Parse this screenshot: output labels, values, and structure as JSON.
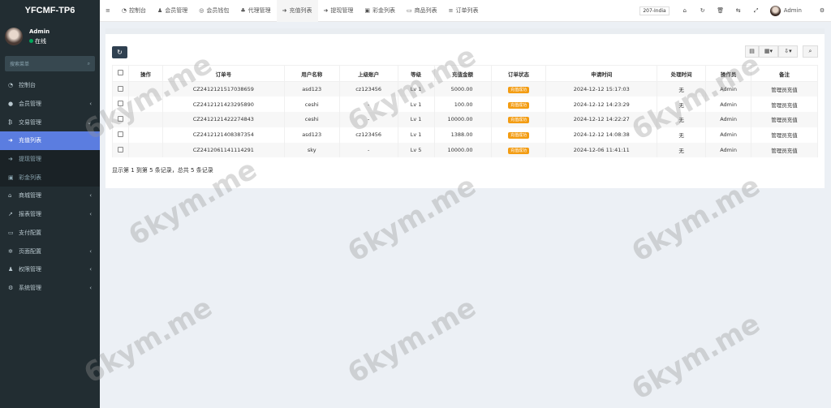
{
  "app_title": "YFCMF-TP6",
  "user": {
    "name": "Admin",
    "status": "在线"
  },
  "search_placeholder": "搜索菜单",
  "sidebar": {
    "items": [
      {
        "label": "控制台",
        "icon": "dashboard-icon",
        "arrow": ""
      },
      {
        "label": "会员管理",
        "icon": "user-circle-icon",
        "arrow": "‹"
      },
      {
        "label": "交易管理",
        "icon": "bitcoin-icon",
        "arrow": "⌄"
      },
      {
        "label": "充值列表",
        "icon": "sign-in-icon",
        "arrow": "",
        "state": "active"
      },
      {
        "label": "提现管理",
        "icon": "sign-out-icon",
        "arrow": "",
        "state": "sub"
      },
      {
        "label": "彩金列表",
        "icon": "gift-icon",
        "arrow": "",
        "state": "sub"
      },
      {
        "label": "商城管理",
        "icon": "home-icon",
        "arrow": "‹"
      },
      {
        "label": "报表管理",
        "icon": "line-chart-icon",
        "arrow": "‹"
      },
      {
        "label": "支付配置",
        "icon": "credit-card-icon",
        "arrow": ""
      },
      {
        "label": "页面配置",
        "icon": "gear-icon",
        "arrow": "‹"
      },
      {
        "label": "权限管理",
        "icon": "users-icon",
        "arrow": "‹"
      },
      {
        "label": "系统管理",
        "icon": "cogs-icon",
        "arrow": "‹"
      }
    ]
  },
  "tabs": [
    {
      "label": "控制台",
      "icon": "dashboard-icon"
    },
    {
      "label": "会员管理",
      "icon": "user-icon"
    },
    {
      "label": "会员钱包",
      "icon": "wallet-icon"
    },
    {
      "label": "代理管理",
      "icon": "sitemap-icon"
    },
    {
      "label": "充值列表",
      "icon": "sign-in-icon",
      "active": true
    },
    {
      "label": "提现管理",
      "icon": "sign-out-icon"
    },
    {
      "label": "彩金列表",
      "icon": "gift-icon"
    },
    {
      "label": "商品列表",
      "icon": "desktop-icon"
    },
    {
      "label": "订单列表",
      "icon": "list-icon"
    }
  ],
  "topbar": {
    "language": "207-India",
    "admin": "Admin"
  },
  "table": {
    "headers": [
      "操作",
      "订单号",
      "用户名称",
      "上级账户",
      "等级",
      "充值金额",
      "订单状态",
      "申请时间",
      "处理时间",
      "操作员",
      "备注"
    ],
    "rows": [
      [
        "",
        "CZ2412121517038659",
        "asd123",
        "cz123456",
        "Lv 1",
        "5000.00",
        "充值成功",
        "2024-12-12 15:17:03",
        "无",
        "Admin",
        "管理员充值"
      ],
      [
        "",
        "CZ2412121423295890",
        "ceshi",
        "-",
        "Lv 1",
        "100.00",
        "充值成功",
        "2024-12-12 14:23:29",
        "无",
        "Admin",
        "管理员充值"
      ],
      [
        "",
        "CZ2412121422274843",
        "ceshi",
        "-",
        "Lv 1",
        "10000.00",
        "充值成功",
        "2024-12-12 14:22:27",
        "无",
        "Admin",
        "管理员充值"
      ],
      [
        "",
        "CZ2412121408387354",
        "asd123",
        "cz123456",
        "Lv 1",
        "1388.00",
        "充值成功",
        "2024-12-12 14:08:38",
        "无",
        "Admin",
        "管理员充值"
      ],
      [
        "",
        "CZ2412061141114291",
        "sky",
        "-",
        "Lv 5",
        "10000.00",
        "充值成功",
        "2024-12-06 11:41:11",
        "无",
        "Admin",
        "管理员充值"
      ]
    ]
  },
  "pagination_text": "显示第 1 到第 5 条记录，总共 5 条记录",
  "colors": {
    "sidebar": "#222d32",
    "active": "#5b7de0",
    "badge": "#f39c12"
  },
  "watermark": "6kym.me"
}
